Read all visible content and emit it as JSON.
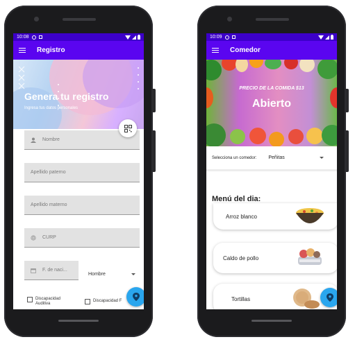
{
  "left": {
    "status_time": "10:08",
    "appbar_title": "Registro",
    "banner_title": "Genera tu registro",
    "banner_subtitle": "Ingresa tus datos personales",
    "fields": {
      "nombre": "Nombre",
      "apellido_paterno": "Apellido paterno",
      "apellido_materno": "Apellido materno",
      "curp": "CURP",
      "fecha": "F. de naci..."
    },
    "gender_value": "Hombre",
    "checkbox_1": [
      "Discapacidad",
      "Auditiva"
    ],
    "checkbox_2": "Discapacidad F",
    "icons": {
      "menu": "menu-icon",
      "qr": "qr-code-icon",
      "person": "person-icon",
      "fingerprint": "fingerprint-icon",
      "calendar": "calendar-icon",
      "location": "location-pin-icon"
    }
  },
  "right": {
    "status_time": "10:09",
    "appbar_title": "Comedor",
    "banner_price": "PRECIO DE LA COMIDA $13",
    "banner_status": "Abierto",
    "selector_label": "Selecciona un comedor:",
    "selector_value": "Peñitas",
    "menu_heading": "Menú del dia:",
    "menu_items": [
      "Arroz blanco",
      "Caldo de pollo",
      "Tortillas"
    ]
  },
  "colors": {
    "status_bar": "#3c00c9",
    "app_bar": "#5a05f0",
    "fab": "#2aa6ee"
  }
}
